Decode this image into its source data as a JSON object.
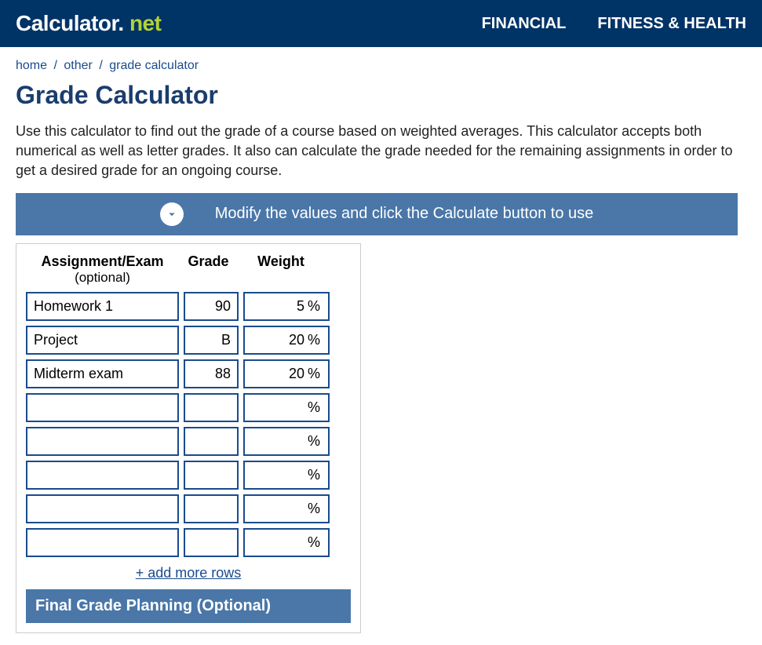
{
  "header": {
    "logo_main": "Calculator",
    "logo_dot": ".",
    "logo_net": "net",
    "nav": [
      "FINANCIAL",
      "FITNESS & HEALTH"
    ]
  },
  "breadcrumb": {
    "items": [
      "home",
      "other",
      "grade calculator"
    ],
    "sep": "/"
  },
  "title": "Grade Calculator",
  "description": "Use this calculator to find out the grade of a course based on weighted averages. This calculator accepts both numerical as well as letter grades. It also can calculate the grade needed for the remaining assignments in order to get a desired grade for an ongoing course.",
  "banner": "Modify the values and click the Calculate button to use",
  "table": {
    "col_assign": "Assignment/Exam",
    "col_assign_opt": "(optional)",
    "col_grade": "Grade",
    "col_weight": "Weight",
    "percent": "%",
    "rows": [
      {
        "assign": "Homework 1",
        "grade": "90",
        "weight": "5"
      },
      {
        "assign": "Project",
        "grade": "B",
        "weight": "20"
      },
      {
        "assign": "Midterm exam",
        "grade": "88",
        "weight": "20"
      },
      {
        "assign": "",
        "grade": "",
        "weight": ""
      },
      {
        "assign": "",
        "grade": "",
        "weight": ""
      },
      {
        "assign": "",
        "grade": "",
        "weight": ""
      },
      {
        "assign": "",
        "grade": "",
        "weight": ""
      },
      {
        "assign": "",
        "grade": "",
        "weight": ""
      }
    ],
    "add_rows": "+ add more rows"
  },
  "final_section": "Final Grade Planning (Optional)"
}
